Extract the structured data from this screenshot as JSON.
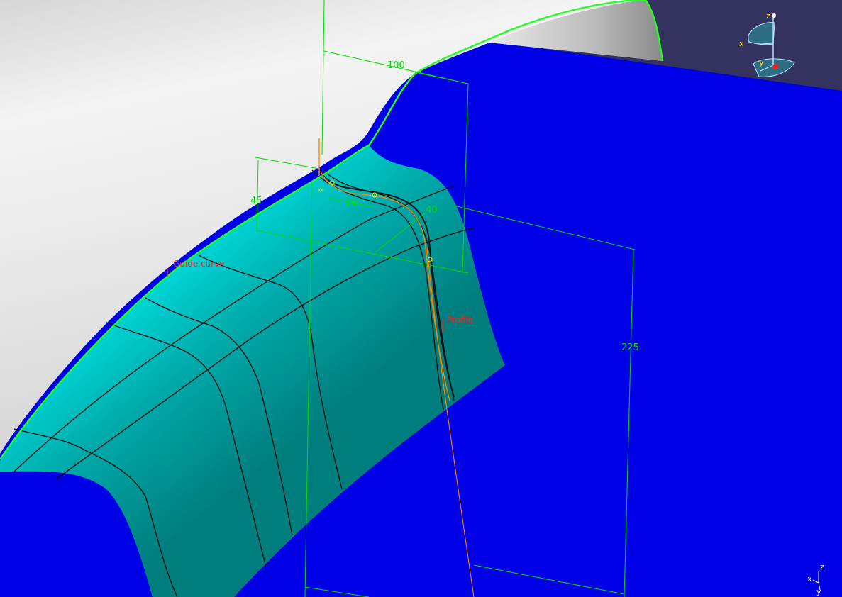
{
  "viewport": {
    "colors": {
      "background_top": "#34335f",
      "blue_plane": "#0000e6",
      "grey_surface": "#e8e8e8",
      "cyan_surface": "#00e5e5",
      "teal_surface": "#007e7e",
      "dimension_green": "#00dd00",
      "curve_green": "#22ff22",
      "profile_orange": "#ff8800",
      "label_red": "#ff2020",
      "axis_light": "#bfe8ff"
    },
    "dimensions": {
      "d100": "100",
      "d45": "45",
      "d30": "30",
      "d40": "40",
      "d225": "225"
    },
    "labels": {
      "guide_curve": "Guide curve",
      "profile": "Profile"
    },
    "compass": {
      "z": "z",
      "x": "x",
      "y": "y"
    },
    "mini_axis": {
      "z": "z",
      "x": "x",
      "y": "y"
    }
  }
}
